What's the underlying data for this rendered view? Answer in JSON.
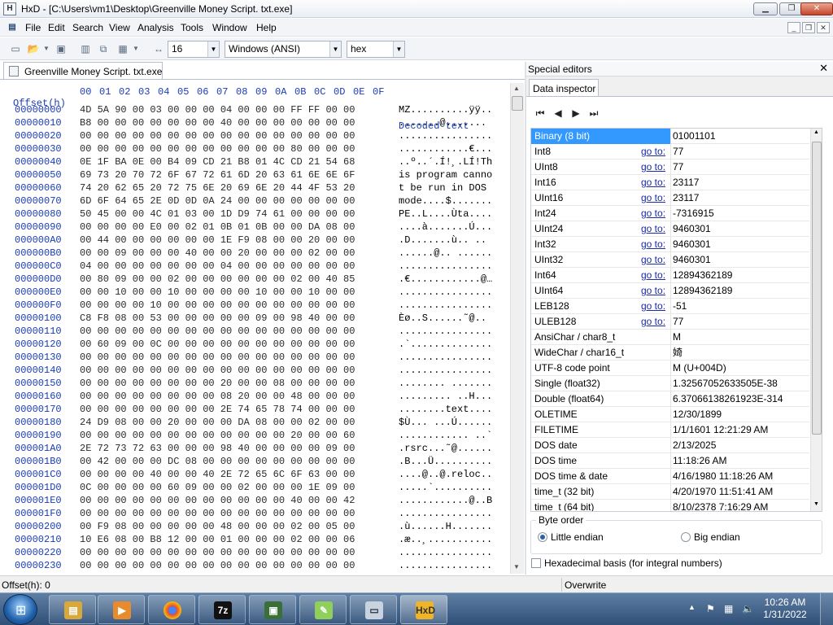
{
  "window": {
    "title": "HxD - [C:\\Users\\vm1\\Desktop\\Greenville Money Script. txt.exe]"
  },
  "menu": [
    "File",
    "Edit",
    "Search",
    "View",
    "Analysis",
    "Tools",
    "Window",
    "Help"
  ],
  "toolbar": {
    "bytes_per_row": "16",
    "charset": "Windows (ANSI)",
    "display": "hex"
  },
  "doc_tab": "Greenville Money Script. txt.exe",
  "hex": {
    "offset_header": "Offset(h)",
    "columns": [
      "00",
      "01",
      "02",
      "03",
      "04",
      "05",
      "06",
      "07",
      "08",
      "09",
      "0A",
      "0B",
      "0C",
      "0D",
      "0E",
      "0F"
    ],
    "decoded_header": "Decoded text",
    "rows": [
      {
        "off": "00000000",
        "bytes": "4D 5A 90 00 03 00 00 00 04 00 00 00 FF FF 00 00",
        "text": "MZ..........ÿÿ.."
      },
      {
        "off": "00000010",
        "bytes": "B8 00 00 00 00 00 00 00 40 00 00 00 00 00 00 00",
        "text": ".......@......."
      },
      {
        "off": "00000020",
        "bytes": "00 00 00 00 00 00 00 00 00 00 00 00 00 00 00 00",
        "text": "................"
      },
      {
        "off": "00000030",
        "bytes": "00 00 00 00 00 00 00 00 00 00 00 00 80 00 00 00",
        "text": "............€..."
      },
      {
        "off": "00000040",
        "bytes": "0E 1F BA 0E 00 B4 09 CD 21 B8 01 4C CD 21 54 68",
        "text": "..º..´.Í!¸.LÍ!Th"
      },
      {
        "off": "00000050",
        "bytes": "69 73 20 70 72 6F 67 72 61 6D 20 63 61 6E 6E 6F",
        "text": "is program canno"
      },
      {
        "off": "00000060",
        "bytes": "74 20 62 65 20 72 75 6E 20 69 6E 20 44 4F 53 20",
        "text": "t be run in DOS "
      },
      {
        "off": "00000070",
        "bytes": "6D 6F 64 65 2E 0D 0D 0A 24 00 00 00 00 00 00 00",
        "text": "mode....$......."
      },
      {
        "off": "00000080",
        "bytes": "50 45 00 00 4C 01 03 00 1D D9 74 61 00 00 00 00",
        "text": "PE..L....Ùta...."
      },
      {
        "off": "00000090",
        "bytes": "00 00 00 00 E0 00 02 01 0B 01 0B 00 00 DA 08 00",
        "text": "....à.......Ú..."
      },
      {
        "off": "000000A0",
        "bytes": "00 44 00 00 00 00 00 00 1E F9 08 00 00 20 00 00",
        "text": ".D.......ù.. .."
      },
      {
        "off": "000000B0",
        "bytes": "00 00 09 00 00 00 40 00 00 20 00 00 00 02 00 00",
        "text": "......@.. ......"
      },
      {
        "off": "000000C0",
        "bytes": "04 00 00 00 00 00 00 00 04 00 00 00 00 00 00 00",
        "text": "................"
      },
      {
        "off": "000000D0",
        "bytes": "00 80 09 00 00 02 00 00 00 00 00 00 02 00 40 85",
        "text": ".€............@…"
      },
      {
        "off": "000000E0",
        "bytes": "00 00 10 00 00 10 00 00 00 00 10 00 00 10 00 00",
        "text": "................"
      },
      {
        "off": "000000F0",
        "bytes": "00 00 00 00 10 00 00 00 00 00 00 00 00 00 00 00",
        "text": "................"
      },
      {
        "off": "00000100",
        "bytes": "C8 F8 08 00 53 00 00 00 00 00 09 00 98 40 00 00",
        "text": "Èø..S......˜@.."
      },
      {
        "off": "00000110",
        "bytes": "00 00 00 00 00 00 00 00 00 00 00 00 00 00 00 00",
        "text": "................"
      },
      {
        "off": "00000120",
        "bytes": "00 60 09 00 0C 00 00 00 00 00 00 00 00 00 00 00",
        "text": ".`.............."
      },
      {
        "off": "00000130",
        "bytes": "00 00 00 00 00 00 00 00 00 00 00 00 00 00 00 00",
        "text": "................"
      },
      {
        "off": "00000140",
        "bytes": "00 00 00 00 00 00 00 00 00 00 00 00 00 00 00 00",
        "text": "................"
      },
      {
        "off": "00000150",
        "bytes": "00 00 00 00 00 00 00 00 20 00 00 08 00 00 00 00",
        "text": "........ ......."
      },
      {
        "off": "00000160",
        "bytes": "00 00 00 00 00 00 00 00 08 20 00 00 48 00 00 00",
        "text": "......... ..H..."
      },
      {
        "off": "00000170",
        "bytes": "00 00 00 00 00 00 00 00 2E 74 65 78 74 00 00 00",
        "text": "........text...."
      },
      {
        "off": "00000180",
        "bytes": "24 D9 08 00 00 20 00 00 00 DA 08 00 00 02 00 00",
        "text": "$Ù... ...Ú......"
      },
      {
        "off": "00000190",
        "bytes": "00 00 00 00 00 00 00 00 00 00 00 00 20 00 00 60",
        "text": "............ ..`"
      },
      {
        "off": "000001A0",
        "bytes": "2E 72 73 72 63 00 00 00 98 40 00 00 00 00 09 00",
        "text": ".rsrc...˜@......"
      },
      {
        "off": "000001B0",
        "bytes": "00 42 00 00 00 DC 08 00 00 00 00 00 00 00 00 00",
        "text": ".B...Ü.........."
      },
      {
        "off": "000001C0",
        "bytes": "00 00 00 00 40 00 00 40 2E 72 65 6C 6F 63 00 00",
        "text": "....@..@.reloc.."
      },
      {
        "off": "000001D0",
        "bytes": "0C 00 00 00 00 60 09 00 00 02 00 00 00 1E 09 00",
        "text": ".....`.........."
      },
      {
        "off": "000001E0",
        "bytes": "00 00 00 00 00 00 00 00 00 00 00 00 40 00 00 42",
        "text": "............@..B"
      },
      {
        "off": "000001F0",
        "bytes": "00 00 00 00 00 00 00 00 00 00 00 00 00 00 00 00",
        "text": "................"
      },
      {
        "off": "00000200",
        "bytes": "00 F9 08 00 00 00 00 00 48 00 00 00 02 00 05 00",
        "text": ".ù......H......."
      },
      {
        "off": "00000210",
        "bytes": "10 E6 08 00 B8 12 00 00 01 00 00 00 02 00 00 06",
        "text": ".æ..¸..........."
      },
      {
        "off": "00000220",
        "bytes": "00 00 00 00 00 00 00 00 00 00 00 00 00 00 00 00",
        "text": "................"
      },
      {
        "off": "00000230",
        "bytes": "00 00 00 00 00 00 00 00 00 00 00 00 00 00 00 00",
        "text": "................"
      }
    ]
  },
  "side": {
    "header": "Special editors",
    "tab": "Data inspector",
    "goto_label": "go to:",
    "rows": [
      {
        "name": "Binary (8 bit)",
        "value": "01001101",
        "goto": false,
        "selected": true
      },
      {
        "name": "Int8",
        "value": "77",
        "goto": true
      },
      {
        "name": "UInt8",
        "value": "77",
        "goto": true
      },
      {
        "name": "Int16",
        "value": "23117",
        "goto": true
      },
      {
        "name": "UInt16",
        "value": "23117",
        "goto": true
      },
      {
        "name": "Int24",
        "value": "-7316915",
        "goto": true
      },
      {
        "name": "UInt24",
        "value": "9460301",
        "goto": true
      },
      {
        "name": "Int32",
        "value": "9460301",
        "goto": true
      },
      {
        "name": "UInt32",
        "value": "9460301",
        "goto": true
      },
      {
        "name": "Int64",
        "value": "12894362189",
        "goto": true
      },
      {
        "name": "UInt64",
        "value": "12894362189",
        "goto": true
      },
      {
        "name": "LEB128",
        "value": "-51",
        "goto": true
      },
      {
        "name": "ULEB128",
        "value": "77",
        "goto": true
      },
      {
        "name": "AnsiChar / char8_t",
        "value": "M",
        "goto": false
      },
      {
        "name": "WideChar / char16_t",
        "value": "婍",
        "goto": false
      },
      {
        "name": "UTF-8 code point",
        "value": "M (U+004D)",
        "goto": false
      },
      {
        "name": "Single (float32)",
        "value": "1.32567052633505E-38",
        "goto": false
      },
      {
        "name": "Double (float64)",
        "value": "6.37066138261923E-314",
        "goto": false
      },
      {
        "name": "OLETIME",
        "value": "12/30/1899",
        "goto": false
      },
      {
        "name": "FILETIME",
        "value": "1/1/1601 12:21:29 AM",
        "goto": false
      },
      {
        "name": "DOS date",
        "value": "2/13/2025",
        "goto": false
      },
      {
        "name": "DOS time",
        "value": "11:18:26 AM",
        "goto": false
      },
      {
        "name": "DOS time & date",
        "value": "4/16/1980 11:18:26 AM",
        "goto": false
      },
      {
        "name": "time_t (32 bit)",
        "value": "4/20/1970 11:51:41 AM",
        "goto": false
      },
      {
        "name": "time_t (64 bit)",
        "value": "8/10/2378 7:16:29 AM",
        "goto": false
      }
    ],
    "byte_order": {
      "label": "Byte order",
      "little": "Little endian",
      "big": "Big endian"
    },
    "hex_basis": "Hexadecimal basis (for integral numbers)"
  },
  "status": {
    "offset": "Offset(h): 0",
    "mode": "Overwrite"
  },
  "taskbar": {
    "time": "10:26 AM",
    "date": "1/31/2022"
  },
  "colors": {
    "offset_blue": "#1a3bb5",
    "selection": "#3399ff"
  }
}
